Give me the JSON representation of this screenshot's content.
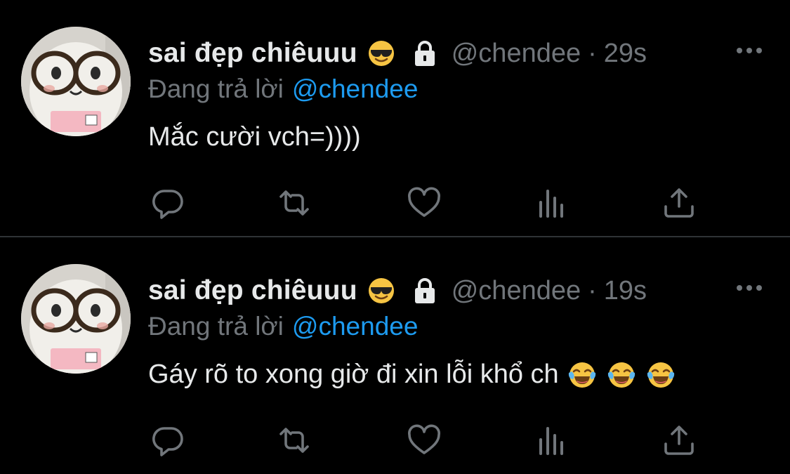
{
  "colors": {
    "background": "#000000",
    "primary_text": "#e7e9ea",
    "secondary_text": "#71767b",
    "link": "#1d9bf0",
    "divider": "#2f3336"
  },
  "tweets": [
    {
      "display_name": "sai đẹp chiêuuu",
      "name_emoji": "smiling-face-with-sunglasses",
      "protected_icon": "lock-icon",
      "handle": "@chendee",
      "separator": "·",
      "time": "29s",
      "reply_prefix": "Đang trả lời",
      "reply_handle": "@chendee",
      "text": "Mắc cười vch=))))",
      "trailing_emojis": [],
      "actions": [
        "reply-icon",
        "retweet-icon",
        "like-icon",
        "views-icon",
        "share-icon"
      ]
    },
    {
      "display_name": "sai đẹp chiêuuu",
      "name_emoji": "smiling-face-with-sunglasses",
      "protected_icon": "lock-icon",
      "handle": "@chendee",
      "separator": "·",
      "time": "19s",
      "reply_prefix": "Đang trả lời",
      "reply_handle": "@chendee",
      "text": "Gáy rõ to xong giờ đi xin lỗi khổ ch",
      "trailing_emojis": [
        "face-with-tears-of-joy",
        "face-with-tears-of-joy",
        "face-with-tears-of-joy"
      ],
      "actions": [
        "reply-icon",
        "retweet-icon",
        "like-icon",
        "views-icon",
        "share-icon"
      ]
    }
  ]
}
